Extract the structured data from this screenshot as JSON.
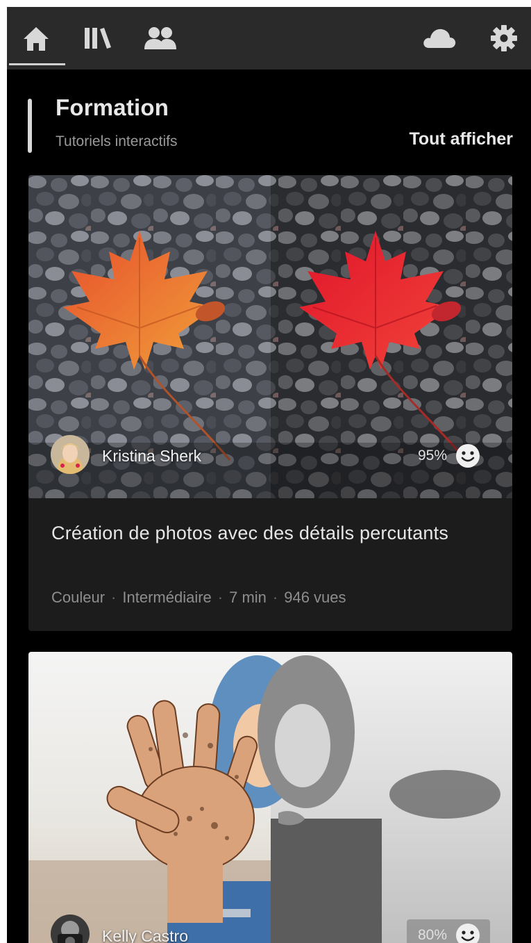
{
  "nav": {
    "items": [
      {
        "name": "home",
        "icon": "home-icon",
        "active": true
      },
      {
        "name": "library",
        "icon": "library-icon"
      },
      {
        "name": "community",
        "icon": "people-icon"
      }
    ],
    "right": [
      {
        "name": "cloud",
        "icon": "cloud-icon"
      },
      {
        "name": "settings",
        "icon": "gear-icon"
      }
    ]
  },
  "section": {
    "title": "Formation",
    "subtitle": "Tutoriels interactifs",
    "see_all": "Tout afficher"
  },
  "cards": [
    {
      "author": "Kristina Sherk",
      "rating": "95%",
      "rating_icon": "smiley-icon",
      "title": "Création de photos avec des détails percutants",
      "meta": [
        "Couleur",
        "Intermédiaire",
        "7 min",
        "946 vues"
      ]
    },
    {
      "author": "Kelly Castro",
      "rating": "80%",
      "rating_icon": "smiley-icon"
    }
  ],
  "colors": {
    "background": "#000000",
    "topbar": "#2a2a2a",
    "card": "#1c1c1c",
    "leaf_before": "#e2612a",
    "leaf_after": "#e41f2b"
  }
}
